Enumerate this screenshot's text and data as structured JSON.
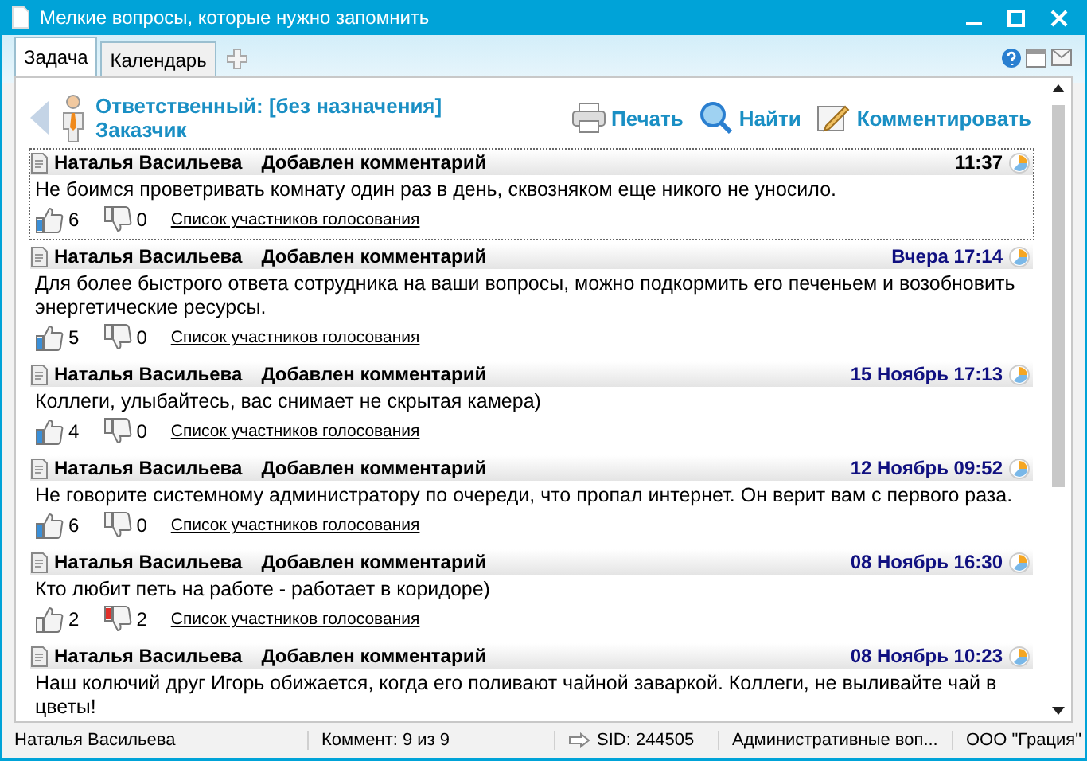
{
  "window": {
    "title": "Мелкие вопросы, которые нужно запомнить"
  },
  "tabs": [
    {
      "label": "Задача",
      "selected": true
    },
    {
      "label": "Календарь",
      "selected": false
    }
  ],
  "header": {
    "responsible": "Ответственный: [без назначения]",
    "customer": "Заказчик"
  },
  "actions": [
    "Печать",
    "Найти",
    "Комментировать"
  ],
  "comments": [
    {
      "author": "Наталья Васильева",
      "action": "Добавлен комментарий",
      "time": "11:37",
      "recent": true,
      "selected": true,
      "text": "Не боимся проветривать комнату один раз в день, сквозняком еще никого не уносило.",
      "likes": "6",
      "dislikes": "0",
      "liked": true,
      "disliked": false,
      "voters": "Список участников голосования"
    },
    {
      "author": "Наталья Васильева",
      "action": "Добавлен комментарий",
      "time": "Вчера 17:14",
      "recent": false,
      "selected": false,
      "text": "Для более быстрого ответа сотрудника на ваши вопросы, можно подкормить его печеньем и возобновить энергетические ресурсы.",
      "likes": "5",
      "dislikes": "0",
      "liked": true,
      "disliked": false,
      "voters": "Список участников голосования"
    },
    {
      "author": "Наталья Васильева",
      "action": "Добавлен комментарий",
      "time": "15 Ноябрь 17:13",
      "recent": false,
      "selected": false,
      "text": "Коллеги, улыбайтесь, вас снимает не скрытая камера)",
      "likes": "4",
      "dislikes": "0",
      "liked": true,
      "disliked": false,
      "voters": "Список участников голосования"
    },
    {
      "author": "Наталья Васильева",
      "action": "Добавлен комментарий",
      "time": "12 Ноябрь 09:52",
      "recent": false,
      "selected": false,
      "text": "Не говорите системному администратору по очереди, что пропал интернет. Он верит вам с первого раза.",
      "likes": "6",
      "dislikes": "0",
      "liked": true,
      "disliked": false,
      "voters": "Список участников голосования"
    },
    {
      "author": "Наталья Васильева",
      "action": "Добавлен комментарий",
      "time": "08 Ноябрь 16:30",
      "recent": false,
      "selected": false,
      "text": "Кто любит петь на работе - работает в коридоре)",
      "likes": "2",
      "dislikes": "2",
      "liked": false,
      "disliked": true,
      "voters": "Список участников голосования"
    },
    {
      "author": "Наталья Васильева",
      "action": "Добавлен комментарий",
      "time": "08 Ноябрь 10:23",
      "recent": false,
      "selected": false,
      "text": "Наш колючий друг Игорь обижается, когда его поливают чайной заваркой. Коллеги, не выливайте чай в цветы!"
    }
  ],
  "status_bar": {
    "user": "Наталья Васильева",
    "comments": "Коммент: 9 из 9",
    "sid": "SID: 244505",
    "category": "Административные воп...",
    "company": "ООО \"Грация\""
  }
}
